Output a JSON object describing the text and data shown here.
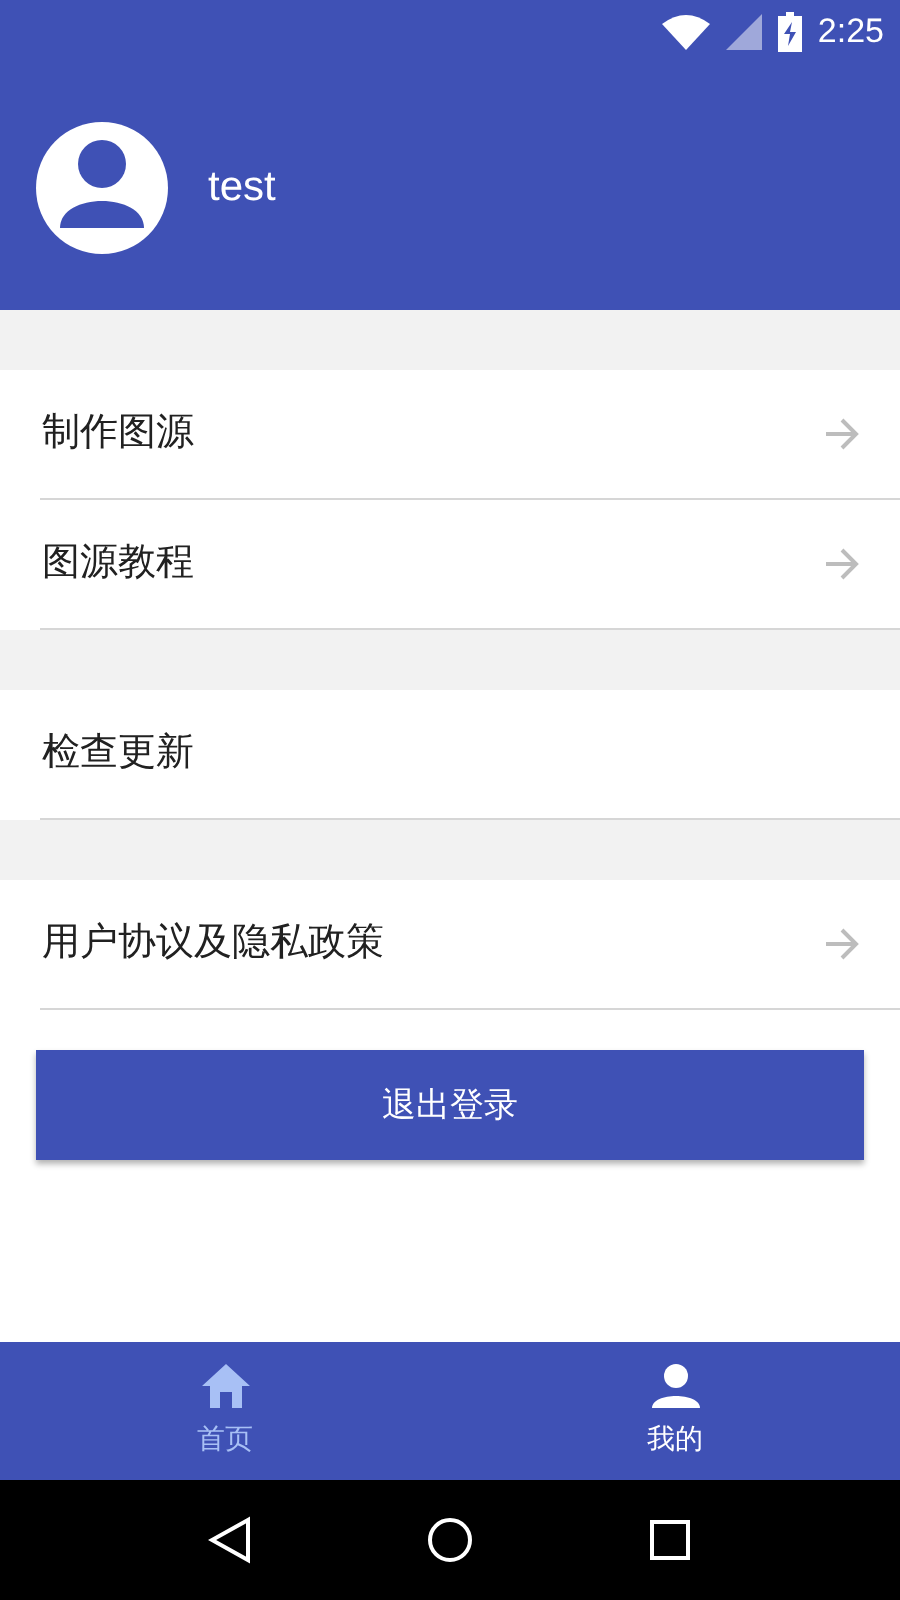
{
  "status_bar": {
    "time": "2:25"
  },
  "profile": {
    "username": "test"
  },
  "menu_groups": [
    {
      "items": [
        {
          "label": "制作图源",
          "arrow": true
        },
        {
          "label": "图源教程",
          "arrow": true
        }
      ]
    },
    {
      "items": [
        {
          "label": "检查更新",
          "arrow": false
        }
      ]
    },
    {
      "items": [
        {
          "label": "用户协议及隐私政策",
          "arrow": true
        }
      ]
    }
  ],
  "logout_button": "退出登录",
  "bottom_nav": [
    {
      "label": "首页",
      "kind": "home",
      "selected": false
    },
    {
      "label": "我的",
      "kind": "profile",
      "selected": true
    }
  ]
}
